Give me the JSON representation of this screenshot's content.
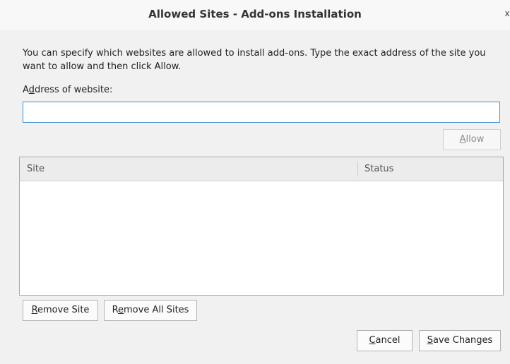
{
  "window": {
    "title": "Allowed Sites - Add-ons Installation",
    "close_glyph": "x"
  },
  "description": "You can specify which websites are allowed to install add-ons. Type the exact address of the site you want to allow and then click Allow.",
  "address": {
    "label_prefix": "A",
    "label_mnemonic": "d",
    "label_suffix": "dress of website:",
    "value": "",
    "placeholder": ""
  },
  "buttons": {
    "allow": {
      "mnemonic": "A",
      "rest": "llow",
      "enabled": false
    },
    "remove_site": {
      "mnemonic": "R",
      "rest": "emove Site"
    },
    "remove_all": {
      "prefix": "R",
      "mnemonic": "e",
      "rest": "move All Sites"
    },
    "cancel": {
      "mnemonic": "C",
      "rest": "ancel"
    },
    "save": {
      "mnemonic": "S",
      "rest": "ave Changes"
    }
  },
  "table": {
    "columns": [
      "Site",
      "Status"
    ],
    "rows": []
  }
}
